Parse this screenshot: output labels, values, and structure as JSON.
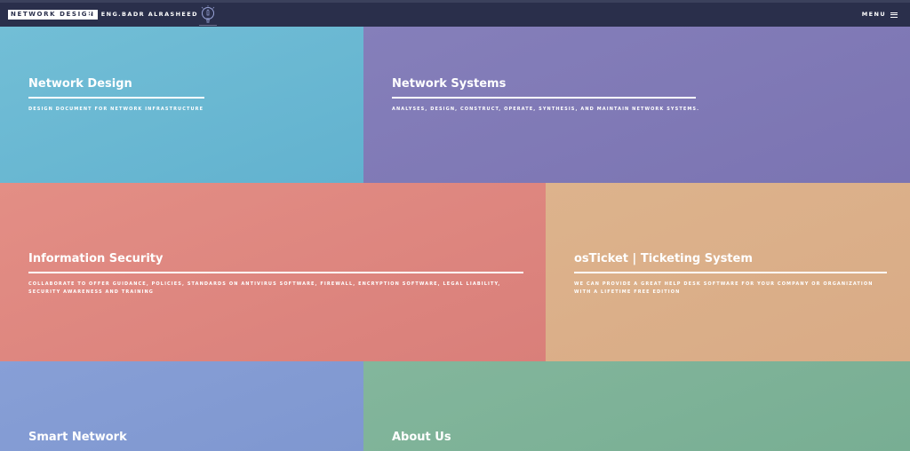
{
  "header": {
    "logo_text": "NETWORK DESIGN",
    "byline": "BY ENG.BADR ALRASHEED",
    "bulb_icon": "lightbulb-icon",
    "menu_label": "MENU",
    "menu_icon": "hamburger-icon"
  },
  "tiles": [
    {
      "title": "Network Design",
      "description": "DESIGN DOCUMENT FOR NETWORK INFRASTRUCTURE",
      "color": "#6db9d3"
    },
    {
      "title": "Network Systems",
      "description": "ANALYSES, DESIGN, CONSTRUCT, OPERATE, SYNTHESIS, AND MAINTAIN NETWORK SYSTEMS.",
      "color": "#807ab6"
    },
    {
      "title": "Information Security",
      "description": "COLLABORATE TO OFFER GUIDANCE, POLICIES, STANDARDS ON ANTIVIRUS SOFTWARE, FIREWALL, ENCRYPTION SOFTWARE, LEGAL LIABILITY, SECURITY AWARENESS AND TRAINING",
      "color": "#df8a82"
    },
    {
      "title": "osTicket | Ticketing System",
      "description": "WE CAN PROVIDE A GREAT HELP DESK SOFTWARE FOR YOUR COMPANY OR ORGANIZATION WITH A LIFETIME FREE EDITION",
      "color": "#dbb08a"
    },
    {
      "title": "Smart Network",
      "description": "",
      "color": "#839bd3"
    },
    {
      "title": "About Us",
      "description": "",
      "color": "#7eb398"
    }
  ]
}
